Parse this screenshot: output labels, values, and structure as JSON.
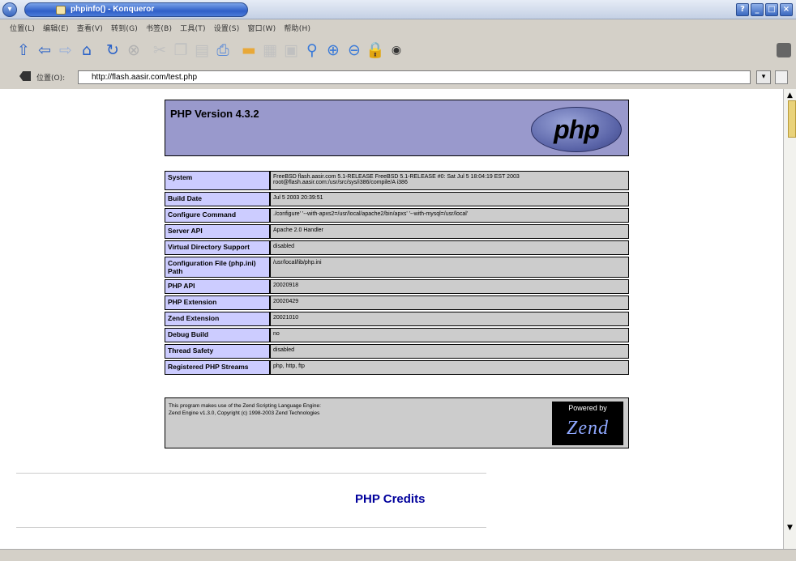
{
  "window": {
    "title": "phpinfo() - Konqueror",
    "controls": [
      "?",
      "_",
      "□",
      "×"
    ]
  },
  "menubar": {
    "items": [
      "位置(L)",
      "编辑(E)",
      "查看(V)",
      "转到(G)",
      "书签(B)",
      "工具(T)",
      "设置(S)",
      "窗口(W)",
      "帮助(H)"
    ]
  },
  "toolbar": {
    "icons": [
      "up-arrow-icon",
      "back-arrow-icon",
      "forward-arrow-icon",
      "home-icon",
      "reload-icon",
      "stop-icon",
      "cut-icon",
      "copy-icon",
      "paste-icon",
      "print-icon",
      "folder-icon",
      "image-icon",
      "window-icon",
      "search-icon",
      "zoom-in-icon",
      "zoom-out-icon",
      "lock-icon",
      "settings-icon"
    ]
  },
  "location": {
    "label": "位置(O):",
    "url": "http://flash.aasir.com/test.php"
  },
  "php": {
    "version_title": "PHP Version 4.3.2",
    "logo_text": "php",
    "rows": [
      {
        "key": "System",
        "value": "FreeBSD flash.aasir.com 5.1-RELEASE FreeBSD 5.1-RELEASE #0: Sat Jul 5 18:04:19 EST 2003 root@flash.aasir.com:/usr/src/sys/i386/compile/A i386"
      },
      {
        "key": "Build Date",
        "value": "Jul 5 2003 20:39:51"
      },
      {
        "key": "Configure Command",
        "value": "./configure' '--with-apxs2=/usr/local/apache2/bin/apxs' '--with-mysql=/usr/local'"
      },
      {
        "key": "Server API",
        "value": "Apache 2.0 Handler"
      },
      {
        "key": "Virtual Directory Support",
        "value": "disabled"
      },
      {
        "key": "Configuration File (php.ini) Path",
        "value": "/usr/local/lib/php.ini"
      },
      {
        "key": "PHP API",
        "value": "20020918"
      },
      {
        "key": "PHP Extension",
        "value": "20020429"
      },
      {
        "key": "Zend Extension",
        "value": "20021010"
      },
      {
        "key": "Debug Build",
        "value": "no"
      },
      {
        "key": "Thread Safety",
        "value": "disabled"
      },
      {
        "key": "Registered PHP Streams",
        "value": "php, http, ftp"
      }
    ],
    "zend_line1": "This program makes use of the Zend Scripting Language Engine:",
    "zend_line2": "Zend Engine v1.3.0, Copyright (c) 1998-2003 Zend Technologies",
    "zend_powered": "Powered by",
    "zend_logo": "Zend",
    "credits": "PHP Credits"
  }
}
